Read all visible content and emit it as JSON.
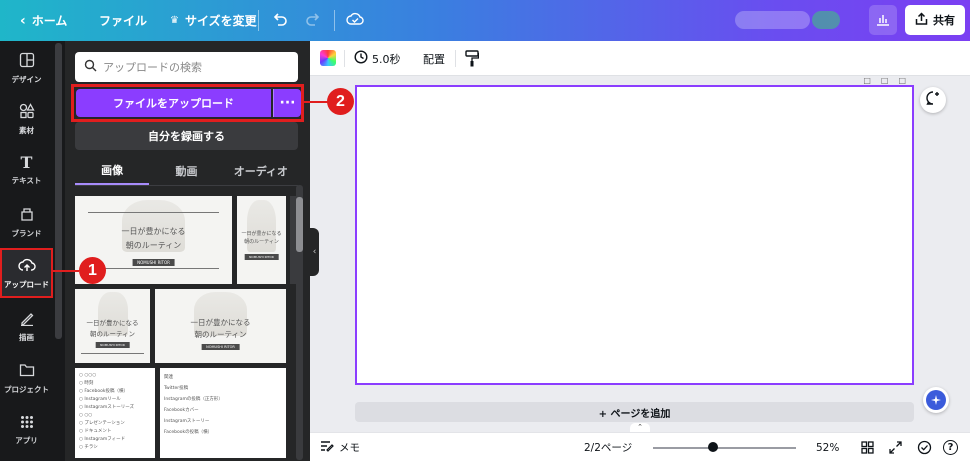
{
  "topbar": {
    "home_label": "ホーム",
    "file_label": "ファイル",
    "resize_label": "サイズを変更",
    "share_label": "共有"
  },
  "rail": {
    "items": [
      {
        "label": "デザイン",
        "icon": "layout-icon"
      },
      {
        "label": "素材",
        "icon": "shapes-icon"
      },
      {
        "label": "テキスト",
        "icon": "text-icon"
      },
      {
        "label": "ブランド",
        "icon": "brand-icon"
      },
      {
        "label": "アップロード",
        "icon": "cloud-upload-icon"
      },
      {
        "label": "描画",
        "icon": "pen-icon"
      },
      {
        "label": "プロジェクト",
        "icon": "folder-icon"
      },
      {
        "label": "アプリ",
        "icon": "apps-grid-icon"
      }
    ]
  },
  "panel": {
    "search_placeholder": "アップロードの検索",
    "upload_button": "ファイルをアップロード",
    "more_button": "···",
    "record_button": "自分を録画する",
    "tabs": [
      "画像",
      "動画",
      "オーディオ"
    ],
    "thumbs": {
      "title_line1": "一日が豊かになる",
      "title_line2": "朝のルーティン",
      "tag": "NOMUSHI RITOR",
      "list1": [
        "○ ○○○",
        "○ 時刻",
        "○ Facebook投稿（横）",
        "○ Instagramリール",
        "○ Instagramストーリーズ",
        "○ ○○",
        "○ プレゼンテーション",
        "○ ドキュメント",
        "○ Instagramフィード",
        "○ チラシ"
      ],
      "list2": [
        "関連",
        "Twitter投稿",
        "Instagramの投稿（正方形）",
        "Facebookカバー",
        "Instagramストーリー",
        "Facebookの投稿（横）"
      ]
    }
  },
  "context_bar": {
    "duration": "5.0秒",
    "position": "配置"
  },
  "canvas": {
    "add_page": "+ ページを追加"
  },
  "footer": {
    "notes": "メモ",
    "page_count": "2/2ページ",
    "zoom": "52%",
    "zoom_level": 0.52
  },
  "annotations": {
    "badge1": "1",
    "badge2": "2"
  },
  "colors": {
    "accent": "#8b3dff",
    "highlight": "#e01e1e"
  }
}
